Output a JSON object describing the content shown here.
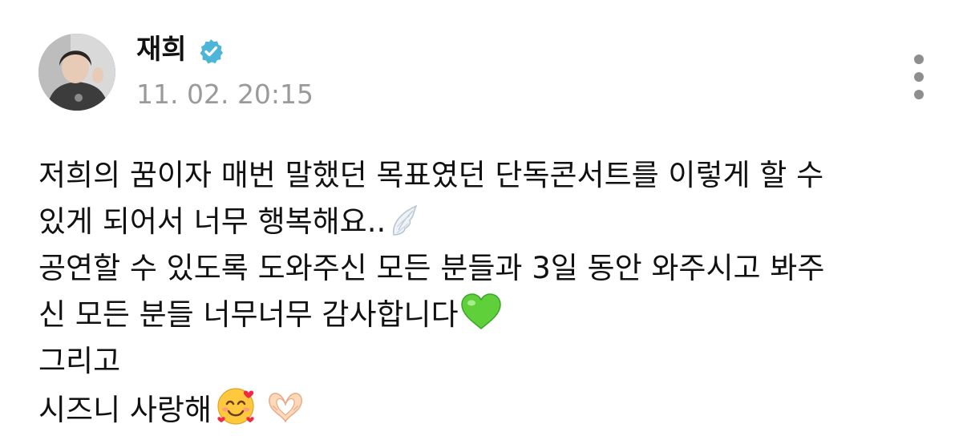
{
  "author": {
    "name": "재희",
    "verified": true
  },
  "post": {
    "timestamp": "11. 02. 20:15",
    "lines": [
      "저희의 꿈이자 매번 말했던 목표였던 단독콘서트를 이렇게 할 수",
      "있게 되어서 너무 행복해요..",
      "공연할 수 있도록 도와주신 모든 분들과 3일 동안 와주시고 봐주",
      "신 모든 분들 너무너무 감사합니다",
      "그리고",
      "시즈니 사랑해"
    ],
    "emojis": {
      "wing": "wing-emoji",
      "heart": "green-heart-emoji",
      "smile": "smiling-face-with-hearts-emoji",
      "hands": "heart-hands-emoji"
    }
  },
  "colors": {
    "verified_badge": "#4cb5d8",
    "timestamp": "#9a9a9a",
    "green_heart": "#5fcf3a"
  }
}
